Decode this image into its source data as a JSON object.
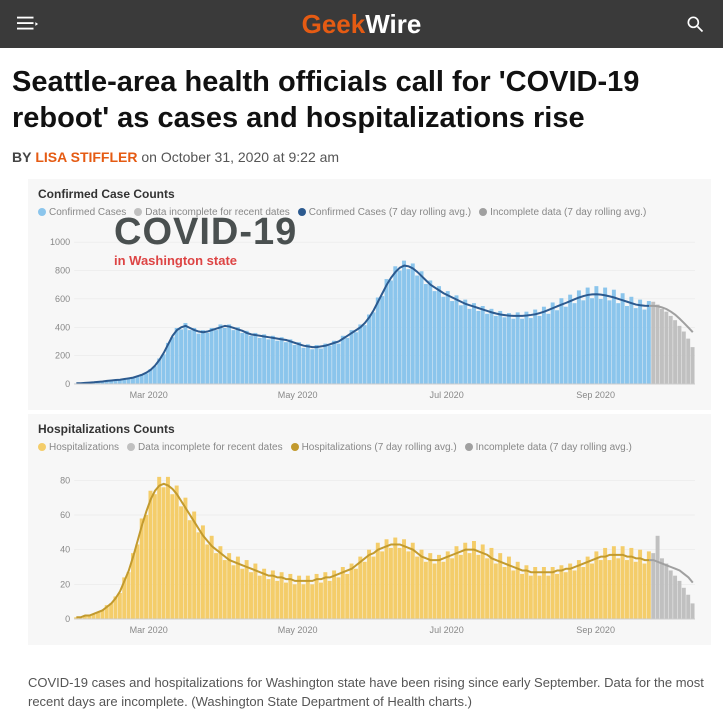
{
  "header": {
    "logo_geek": "Geek",
    "logo_wire": "Wire"
  },
  "article": {
    "headline": "Seattle-area health officials call for 'COVID-19 reboot' as cases and hospitalizations rise",
    "byline_by": "BY",
    "byline_author": "LISA STIFFLER",
    "byline_rest": " on October 31, 2020 at 9:22 am",
    "caption": "COVID-19 cases and hospitalizations for Washington state have been rising since early September. Data for the most recent days are incomplete. (Washington State Department of Health charts.)"
  },
  "overlay": {
    "title": "COVID-19",
    "subtitle": "in Washington state"
  },
  "chart_data": [
    {
      "type": "bar",
      "title": "Confirmed Case Counts",
      "legend": [
        {
          "label": "Confirmed Cases",
          "color": "#8bc5ec"
        },
        {
          "label": "Data incomplete for recent dates",
          "color": "#c0c0c0"
        },
        {
          "label": "Confirmed Cases (7 day rolling avg.)",
          "color": "#2c5a8f"
        },
        {
          "label": "Incomplete data (7 day rolling avg.)",
          "color": "#a0a0a0"
        }
      ],
      "ylabel": "",
      "ylim": [
        0,
        1100
      ],
      "yticks": [
        0,
        200,
        400,
        600,
        800,
        1000
      ],
      "xticks": [
        "Mar 2020",
        "May 2020",
        "Jul 2020",
        "Sep 2020"
      ],
      "series": [
        {
          "name": "Confirmed Cases (bars)",
          "values": [
            5,
            5,
            8,
            10,
            12,
            15,
            18,
            22,
            25,
            28,
            30,
            35,
            40,
            45,
            55,
            65,
            80,
            100,
            130,
            170,
            220,
            280,
            340,
            380,
            400,
            410,
            395,
            380,
            370,
            365,
            370,
            380,
            390,
            400,
            410,
            405,
            395,
            385,
            375,
            360,
            350,
            345,
            340,
            335,
            330,
            325,
            320,
            315,
            310,
            300,
            290,
            280,
            270,
            265,
            260,
            260,
            265,
            270,
            280,
            290,
            300,
            320,
            340,
            360,
            380,
            400,
            430,
            470,
            520,
            580,
            640,
            700,
            750,
            790,
            820,
            835,
            830,
            815,
            790,
            760,
            730,
            700,
            680,
            660,
            640,
            625,
            610,
            595,
            580,
            565,
            555,
            545,
            535,
            525,
            515,
            505,
            497,
            490,
            486,
            482,
            480,
            480,
            480,
            483,
            487,
            492,
            500,
            510,
            522,
            535,
            548,
            560,
            572,
            585,
            598,
            610,
            620,
            628,
            632,
            633,
            630,
            625,
            618,
            610,
            600,
            590,
            580,
            570,
            560,
            555,
            552,
            551
          ]
        },
        {
          "name": "Confirmed Cases daily (bars raw)",
          "values": [
            4,
            6,
            7,
            11,
            10,
            16,
            17,
            24,
            23,
            30,
            28,
            37,
            38,
            48,
            52,
            70,
            75,
            105,
            125,
            180,
            210,
            290,
            330,
            395,
            385,
            430,
            380,
            395,
            355,
            380,
            360,
            395,
            380,
            420,
            395,
            420,
            380,
            400,
            360,
            375,
            340,
            360,
            325,
            350,
            315,
            340,
            305,
            330,
            295,
            315,
            275,
            295,
            255,
            280,
            245,
            275,
            250,
            285,
            270,
            305,
            285,
            340,
            325,
            380,
            365,
            420,
            415,
            490,
            505,
            610,
            620,
            740,
            730,
            830,
            800,
            870,
            810,
            850,
            765,
            795,
            705,
            730,
            655,
            690,
            615,
            655,
            585,
            625,
            555,
            595,
            530,
            570,
            515,
            550,
            495,
            530,
            480,
            515,
            470,
            500,
            460,
            505,
            460,
            510,
            465,
            525,
            480,
            545,
            495,
            575,
            520,
            605,
            545,
            630,
            570,
            660,
            590,
            680,
            605,
            690,
            600,
            680,
            590,
            665,
            570,
            640,
            550,
            615,
            535,
            595,
            525,
            585
          ]
        },
        {
          "name": "Incomplete rolling avg",
          "values_tail": [
            551,
            548,
            540,
            528,
            510,
            488,
            460,
            430,
            398,
            365
          ]
        },
        {
          "name": "Incomplete bars",
          "values_tail": [
            580,
            560,
            530,
            510,
            480,
            450,
            410,
            370,
            320,
            260
          ]
        }
      ]
    },
    {
      "type": "bar",
      "title": "Hospitalizations Counts",
      "legend": [
        {
          "label": "Hospitalizations",
          "color": "#f4cd6a"
        },
        {
          "label": "Data incomplete for recent dates",
          "color": "#c0c0c0"
        },
        {
          "label": "Hospitalizations (7 day rolling avg.)",
          "color": "#c29a2e"
        },
        {
          "label": "Incomplete data (7 day rolling avg.)",
          "color": "#a0a0a0"
        }
      ],
      "ylabel": "",
      "ylim": [
        0,
        90
      ],
      "yticks": [
        0,
        20,
        40,
        60,
        80
      ],
      "xticks": [
        "Mar 2020",
        "May 2020",
        "Jul 2020",
        "Sep 2020"
      ],
      "series": [
        {
          "name": "Hospitalizations rolling avg",
          "values": [
            1,
            1,
            2,
            2,
            3,
            4,
            5,
            7,
            9,
            12,
            16,
            22,
            28,
            36,
            45,
            54,
            62,
            69,
            74,
            77,
            78,
            77,
            75,
            72,
            68,
            64,
            60,
            56,
            52,
            48,
            45,
            42,
            40,
            38,
            36,
            34,
            33,
            32,
            31,
            30,
            29,
            28,
            27,
            26,
            25,
            25,
            24,
            24,
            23,
            23,
            22,
            22,
            22,
            22,
            22,
            23,
            23,
            24,
            24,
            25,
            26,
            27,
            28,
            29,
            31,
            33,
            35,
            37,
            38,
            40,
            41,
            42,
            43,
            43,
            43,
            42,
            41,
            40,
            38,
            36,
            35,
            34,
            34,
            34,
            35,
            36,
            37,
            38,
            39,
            40,
            40,
            40,
            39,
            38,
            37,
            35,
            34,
            33,
            32,
            31,
            30,
            29,
            28,
            28,
            27,
            27,
            27,
            27,
            27,
            27,
            28,
            28,
            29,
            29,
            30,
            31,
            32,
            33,
            34,
            35,
            36,
            36,
            37,
            37,
            37,
            37,
            36,
            36,
            35,
            35,
            34,
            34
          ]
        },
        {
          "name": "Hospitalizations daily bars",
          "values": [
            1,
            1,
            2,
            2,
            3,
            4,
            5,
            8,
            9,
            13,
            15,
            24,
            27,
            38,
            43,
            58,
            60,
            74,
            72,
            82,
            76,
            82,
            72,
            77,
            65,
            70,
            57,
            62,
            50,
            54,
            43,
            48,
            38,
            42,
            34,
            38,
            31,
            36,
            29,
            34,
            27,
            32,
            25,
            29,
            23,
            28,
            22,
            27,
            21,
            26,
            20,
            25,
            20,
            25,
            20,
            26,
            21,
            27,
            22,
            28,
            24,
            30,
            26,
            32,
            29,
            36,
            33,
            40,
            36,
            44,
            39,
            46,
            41,
            47,
            41,
            46,
            39,
            44,
            36,
            40,
            33,
            38,
            32,
            37,
            33,
            39,
            35,
            42,
            37,
            44,
            38,
            45,
            37,
            43,
            35,
            41,
            32,
            38,
            30,
            36,
            28,
            33,
            26,
            31,
            25,
            30,
            25,
            30,
            25,
            30,
            26,
            31,
            27,
            32,
            28,
            34,
            30,
            36,
            32,
            39,
            34,
            41,
            34,
            42,
            35,
            42,
            34,
            41,
            33,
            40,
            32,
            39
          ]
        },
        {
          "name": "Incomplete rolling avg",
          "values_tail": [
            34,
            33,
            32,
            31,
            30,
            29,
            28,
            26,
            24,
            21
          ]
        },
        {
          "name": "Incomplete bars",
          "values_tail": [
            38,
            48,
            35,
            32,
            28,
            25,
            22,
            18,
            14,
            9
          ]
        }
      ]
    }
  ]
}
